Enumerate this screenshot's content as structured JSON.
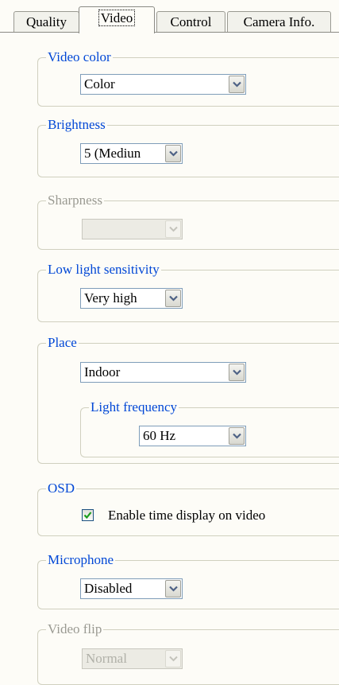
{
  "tabs": [
    {
      "label": "Quality",
      "active": false
    },
    {
      "label": "Video",
      "active": true
    },
    {
      "label": "Control",
      "active": false
    },
    {
      "label": "Camera Info.",
      "active": false
    }
  ],
  "video_color": {
    "legend": "Video color",
    "value": "Color"
  },
  "brightness": {
    "legend": "Brightness",
    "value": "5 (Mediun"
  },
  "sharpness": {
    "legend": "Sharpness",
    "value": "",
    "disabled": true
  },
  "low_light": {
    "legend": "Low light sensitivity",
    "value": "Very high"
  },
  "place": {
    "legend": "Place",
    "value": "Indoor",
    "light_frequency": {
      "legend": "Light frequency",
      "value": "60 Hz"
    }
  },
  "osd": {
    "legend": "OSD",
    "checkbox_label": "Enable time display on video",
    "checked": true
  },
  "microphone": {
    "legend": "Microphone",
    "value": "Disabled"
  },
  "video_flip": {
    "legend": "Video flip",
    "value": "Normal",
    "disabled": true
  },
  "colors": {
    "legend": "#0047d6",
    "disabled_text": "#9a9a92",
    "check": "#1a9c1a"
  }
}
